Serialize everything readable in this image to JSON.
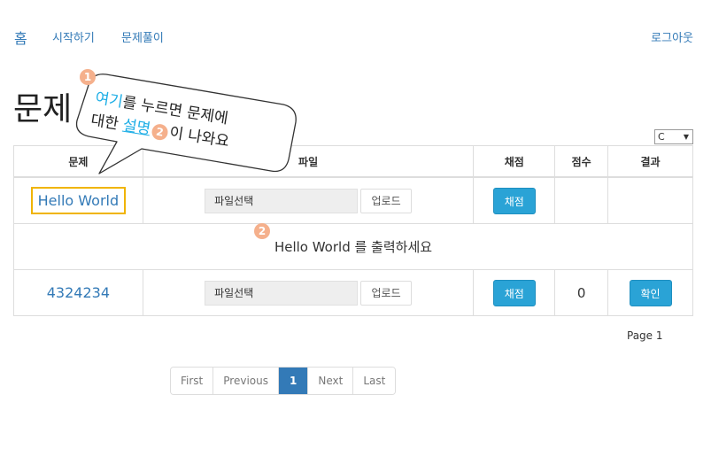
{
  "nav": {
    "home": "홈",
    "start": "시작하기",
    "problems": "문제풀이",
    "logout": "로그아웃"
  },
  "page_title": "문제",
  "language_select": {
    "value": "C"
  },
  "table": {
    "headers": [
      "문제",
      "파일",
      "채점",
      "점수",
      "결과"
    ],
    "rows": [
      {
        "problem": "Hello World",
        "file_placeholder": "파일선택",
        "upload": "업로드",
        "grade": "채점",
        "score": "",
        "result": ""
      },
      {
        "description": "Hello World 를 출력하세요"
      },
      {
        "problem": "4324234",
        "file_placeholder": "파일선택",
        "upload": "업로드",
        "grade": "채점",
        "score": "0",
        "result": "확인"
      }
    ]
  },
  "page_label": "Page 1",
  "pagination": [
    "First",
    "Previous",
    "1",
    "Next",
    "Last"
  ],
  "callout": {
    "badge1": "1",
    "badge2": "2",
    "line1_accent": "여기",
    "line1_rest": "를 누르면 문제에",
    "line2_pre": "대한 ",
    "line2_accent": "설명",
    "line2_post": "이 나와요",
    "badge_desc": "2"
  },
  "colors": {
    "link": "#337ab7",
    "button": "#2aa3d6",
    "highlight": "#f0b400",
    "accent": "#1eaee6",
    "badge": "#f5b08c"
  }
}
